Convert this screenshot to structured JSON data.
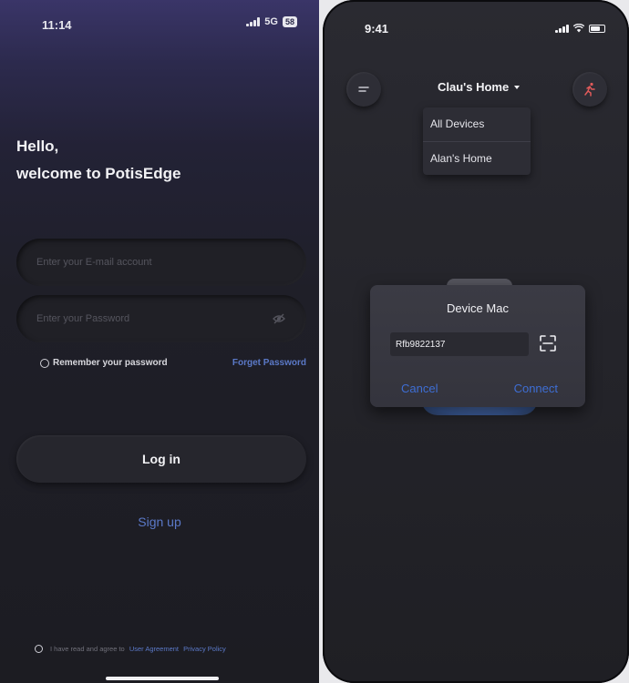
{
  "login_screen": {
    "status_bar": {
      "time": "11:14",
      "network": "5G",
      "battery": "58"
    },
    "greeting_line1": "Hello,",
    "greeting_line2": "welcome to PotisEdge",
    "email": {
      "placeholder": "Enter your E-mail account",
      "value": ""
    },
    "password": {
      "placeholder": "Enter your Password",
      "value": ""
    },
    "remember_label": "Remember your password",
    "forgot_label": "Forget Password",
    "login_label": "Log in",
    "signup_label": "Sign up",
    "agreement": {
      "prefix": "I have read and agree to",
      "user_agreement": "User Agreement",
      "privacy_policy": "Privacy Policy"
    },
    "colors": {
      "link": "#5b79c8",
      "background_top": "#3a3568",
      "background_bottom": "#1c1c22"
    }
  },
  "home_screen": {
    "status_bar": {
      "time": "9:41"
    },
    "home_name": "Clau's Home",
    "dropdown_items": [
      "All Devices",
      "Alan's Home"
    ],
    "dialog": {
      "title": "Device Mac",
      "input_value": "Rfb9822137",
      "cancel_label": "Cancel",
      "connect_label": "Connect"
    },
    "icons": {
      "left_button": "menu-icon",
      "right_button": "running-person-icon",
      "input_action": "scan-icon"
    },
    "colors": {
      "accent": "#3e6ed4"
    }
  }
}
